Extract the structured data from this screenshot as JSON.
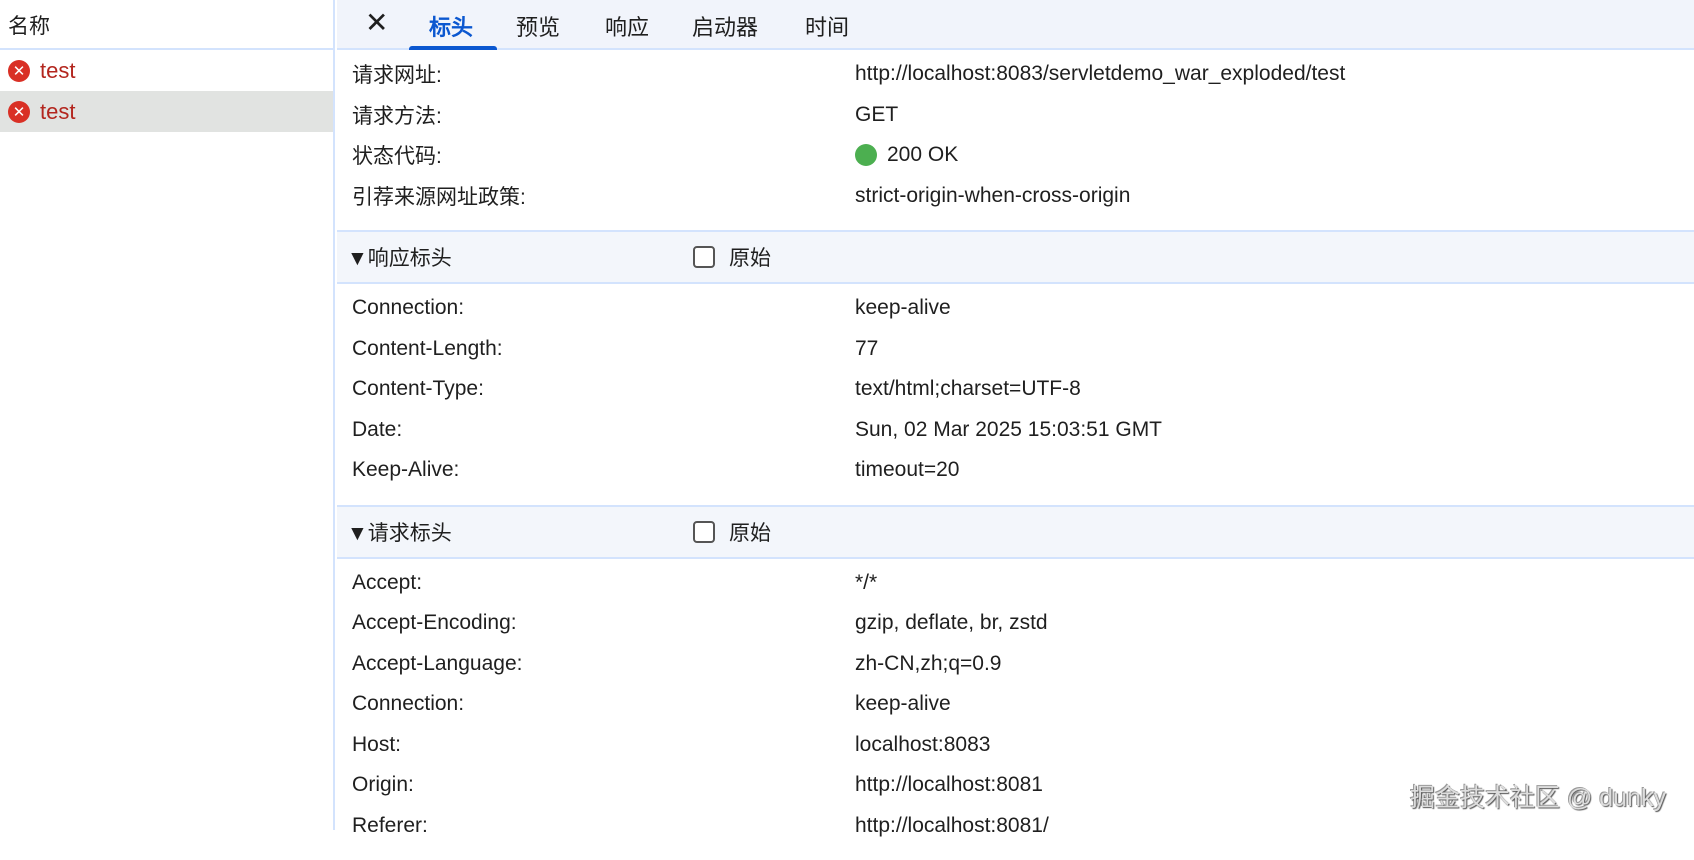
{
  "left": {
    "header": "名称",
    "requests": [
      {
        "name": "test"
      },
      {
        "name": "test"
      }
    ]
  },
  "tabs": {
    "close": "✕",
    "items": [
      "标头",
      "预览",
      "响应",
      "启动器",
      "时间"
    ]
  },
  "general": [
    {
      "k": "请求网址:",
      "v": "http://localhost:8083/servletdemo_war_exploded/test"
    },
    {
      "k": "请求方法:",
      "v": "GET"
    },
    {
      "k": "状态代码:",
      "v": "200 OK"
    },
    {
      "k": "引荐来源网址政策:",
      "v": "strict-origin-when-cross-origin"
    }
  ],
  "response_headers": {
    "title": "▼响应标头",
    "raw": "原始",
    "rows": [
      {
        "k": "Connection:",
        "v": "keep-alive"
      },
      {
        "k": "Content-Length:",
        "v": "77"
      },
      {
        "k": "Content-Type:",
        "v": "text/html;charset=UTF-8"
      },
      {
        "k": "Date:",
        "v": "Sun, 02 Mar 2025 15:03:51 GMT"
      },
      {
        "k": "Keep-Alive:",
        "v": "timeout=20"
      }
    ]
  },
  "request_headers": {
    "title": "▼请求标头",
    "raw": "原始",
    "rows": [
      {
        "k": "Accept:",
        "v": "*/*"
      },
      {
        "k": "Accept-Encoding:",
        "v": "gzip, deflate, br, zstd"
      },
      {
        "k": "Accept-Language:",
        "v": "zh-CN,zh;q=0.9"
      },
      {
        "k": "Connection:",
        "v": "keep-alive"
      },
      {
        "k": "Host:",
        "v": "localhost:8083"
      },
      {
        "k": "Origin:",
        "v": "http://localhost:8081"
      },
      {
        "k": "Referer:",
        "v": "http://localhost:8081/"
      }
    ]
  },
  "watermark": "掘金技术社区 @ dunky"
}
